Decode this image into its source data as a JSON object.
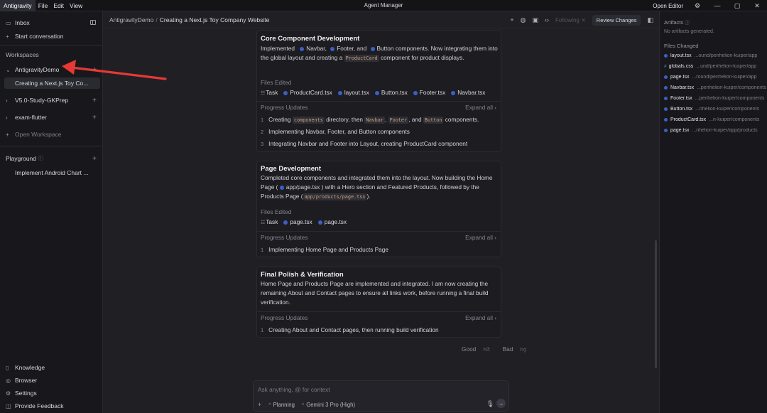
{
  "titlebar": {
    "menus": [
      "Antigravity",
      "File",
      "Edit",
      "View"
    ],
    "app_title": "Agent Manager",
    "open_editor": "Open Editor"
  },
  "sidebar": {
    "inbox": "Inbox",
    "start_conversation": "Start conversation",
    "workspaces_label": "Workspaces",
    "workspaces": [
      {
        "name": "AntigravityDemo",
        "expanded": true,
        "conversations": [
          "Creating a Next.js Toy Co..."
        ]
      },
      {
        "name": "V5.0-Study-GKPrep",
        "expanded": false
      },
      {
        "name": "exam-flutter",
        "expanded": false
      }
    ],
    "open_workspace": "Open Workspace",
    "playground_label": "Playground",
    "playground_items": [
      "Implement Android Chart ..."
    ],
    "footer": [
      "Knowledge",
      "Browser",
      "Settings",
      "Provide Feedback"
    ]
  },
  "main": {
    "breadcrumb": [
      "AntigravityDemo",
      "Creating a Next.js Toy Company Website"
    ],
    "following": "Following",
    "review_changes": "Review Changes",
    "cards": [
      {
        "title": "Core Component Development",
        "body": {
          "a": "Implemented",
          "navbar": "Navbar",
          "b": ",",
          "footer": "Footer",
          "c": ", and",
          "button": "Button",
          "d": " components. Now integrating them into the global layout and creating a",
          "code": "ProductCard",
          "e": "component for product displays."
        },
        "files_label": "Files Edited",
        "task": "Task",
        "files": [
          "ProductCard.tsx",
          "layout.tsx",
          "Button.tsx",
          "Footer.tsx",
          "Navbar.tsx"
        ],
        "progress_label": "Progress Updates",
        "expand_all": "Expand all",
        "steps": [
          {
            "num": "1",
            "a": "Creating",
            "code1": "components",
            "b": "directory, then",
            "code2": "Navbar",
            "c": ",",
            "code3": "Footer",
            "d": ", and",
            "code4": "Button",
            "e": "components."
          },
          {
            "num": "2",
            "text": "Implementing Navbar, Footer, and Button components"
          },
          {
            "num": "3",
            "text": "Integrating Navbar and Footer into Layout, creating ProductCard component"
          }
        ]
      },
      {
        "title": "Page Development",
        "body": {
          "a": "Completed core components and integrated them into the layout. Now building the Home Page (",
          "file": "app/page.tsx",
          "b": ") with a Hero section and Featured Products, followed by the Products Page (",
          "code": "app/products/page.tsx",
          "c": ")."
        },
        "files_label": "Files Edited",
        "task": "Task",
        "files": [
          "page.tsx",
          "page.tsx"
        ],
        "progress_label": "Progress Updates",
        "expand_all": "Expand all",
        "steps": [
          {
            "num": "1",
            "text": "Implementing Home Page and Products Page"
          }
        ]
      },
      {
        "title": "Final Polish & Verification",
        "body": {
          "a": "Home Page and Products Page are implemented and integrated. I am now creating the remaining About and Contact pages to ensure all links work, before running a final build verification."
        },
        "progress_label": "Progress Updates",
        "expand_all": "Expand all",
        "steps": [
          {
            "num": "1",
            "text": "Creating About and Contact pages, then running build verification"
          }
        ]
      }
    ],
    "feedback": {
      "good": "Good",
      "bad": "Bad"
    },
    "composer": {
      "placeholder": "Ask anything, @ for context",
      "mode": "Planning",
      "model": "Gemini 3 Pro (High)"
    }
  },
  "right_panel": {
    "artifacts_label": "Artifacts",
    "no_artifacts": "No artifacts generated.",
    "files_changed_label": "Files Changed",
    "files": [
      {
        "name": "layout.tsx",
        "path": "...ound/perihelion-kuiper/app"
      },
      {
        "name": "globals.css",
        "path": "...und/perihelion-kuiper/app"
      },
      {
        "name": "page.tsx",
        "path": "...round/perihelion-kuiper/app"
      },
      {
        "name": "Navbar.tsx",
        "path": "...perihelion-kuiper/components"
      },
      {
        "name": "Footer.tsx",
        "path": "...perihelion-kuiper/components"
      },
      {
        "name": "Button.tsx",
        "path": "...rihelion-kuiper/components"
      },
      {
        "name": "ProductCard.tsx",
        "path": "...n-kuiper/components"
      },
      {
        "name": "page.tsx",
        "path": "...rihelion-kuiper/app/products"
      }
    ]
  },
  "colors": {
    "accent": "#3b5fc4",
    "annotation": "#e53935"
  },
  "icons": [
    "inbox-icon",
    "plus-icon",
    "chevron-right-icon",
    "chevron-down-icon",
    "book-icon",
    "globe-icon",
    "gear-icon",
    "feedback-icon",
    "mic-icon",
    "send-icon",
    "info-icon"
  ]
}
